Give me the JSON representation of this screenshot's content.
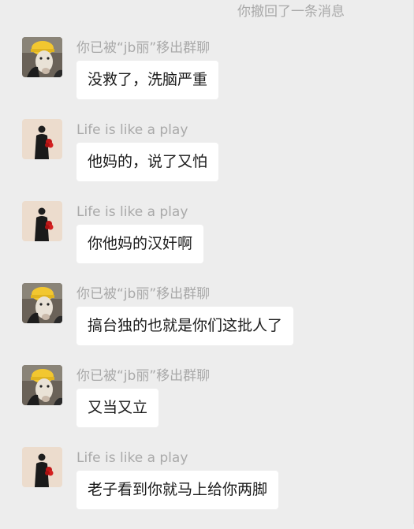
{
  "system_notice": "你撤回了一条消息",
  "messages": [
    {
      "avatar": "dog-with-yellow-hat",
      "sender": "你已被“jb丽”移出群聊",
      "text": "没救了，洗脑严重"
    },
    {
      "avatar": "person-holding-roses",
      "sender": "Life is like a play",
      "text": "他妈的，说了又怕"
    },
    {
      "avatar": "person-holding-roses",
      "sender": "Life is like a play",
      "text": "你他妈的汉奸啊"
    },
    {
      "avatar": "dog-with-yellow-hat",
      "sender": "你已被“jb丽”移出群聊",
      "text": "搞台独的也就是你们这批人了"
    },
    {
      "avatar": "dog-with-yellow-hat",
      "sender": "你已被“jb丽”移出群聊",
      "text": "又当又立"
    },
    {
      "avatar": "person-holding-roses",
      "sender": "Life is like a play",
      "text": "老子看到你就马上给你两脚"
    }
  ]
}
